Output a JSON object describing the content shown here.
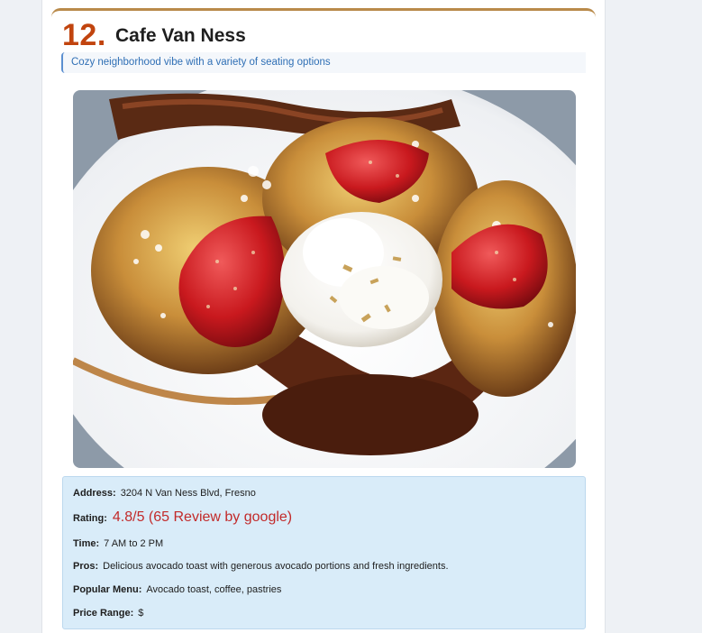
{
  "listing": {
    "rank": "12.",
    "name": "Cafe Van Ness",
    "tagline": "Cozy neighborhood vibe with a variety of seating options",
    "photo_alt": "French toast with strawberries and whipped cream"
  },
  "details": {
    "address_label": "Address:",
    "address_value": "3204 N Van Ness Blvd, Fresno",
    "rating_label": "Rating:",
    "rating_value": "4.8/5 (65 Review by google)",
    "time_label": "Time:",
    "time_value": "7 AM to 2 PM",
    "pros_label": "Pros:",
    "pros_value": "Delicious avocado toast with generous avocado portions and fresh ingredients.",
    "menu_label": "Popular Menu:",
    "menu_value": "Avocado toast, coffee, pastries",
    "price_label": "Price Range:",
    "price_value": "$"
  },
  "colors": {
    "rank": "#c1440e",
    "rating": "#c22a2a",
    "tagline": "#2f6fb5",
    "info_bg": "#d9ecf9",
    "card_top_border": "#b98a4a"
  }
}
